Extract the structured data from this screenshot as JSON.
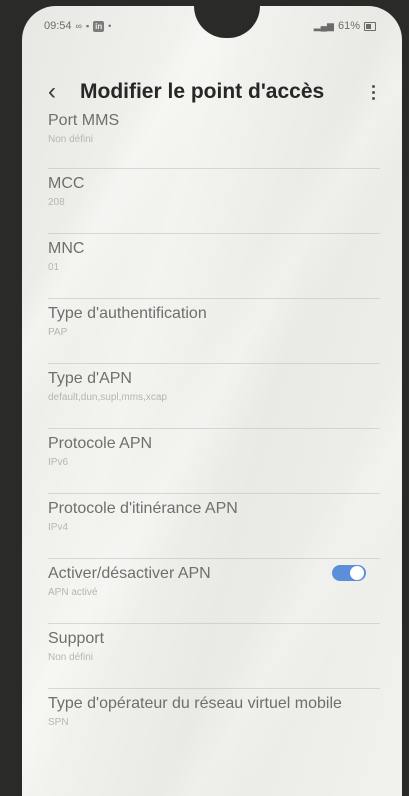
{
  "status_bar": {
    "time": "09:54",
    "battery": "61%"
  },
  "header": {
    "title": "Modifier le point d'accès"
  },
  "items": [
    {
      "label": "Port MMS",
      "value": "Non défini"
    },
    {
      "label": "MCC",
      "value": "208"
    },
    {
      "label": "MNC",
      "value": "01"
    },
    {
      "label": "Type d'authentification",
      "value": "PAP"
    },
    {
      "label": "Type d'APN",
      "value": "default,dun,supl,mms,xcap"
    },
    {
      "label": "Protocole APN",
      "value": "IPv6"
    },
    {
      "label": "Protocole d'itinérance APN",
      "value": "IPv4"
    },
    {
      "label": "Activer/désactiver APN",
      "value": "APN activé",
      "toggle_on": true
    },
    {
      "label": "Support",
      "value": "Non défini"
    },
    {
      "label": "Type d'opérateur du réseau virtuel mobile",
      "value": "SPN"
    }
  ],
  "colors": {
    "toggle_accent": "#5c8fd9"
  },
  "icons": {
    "back": "chevron-left-icon",
    "more": "more-vertical-icon"
  }
}
